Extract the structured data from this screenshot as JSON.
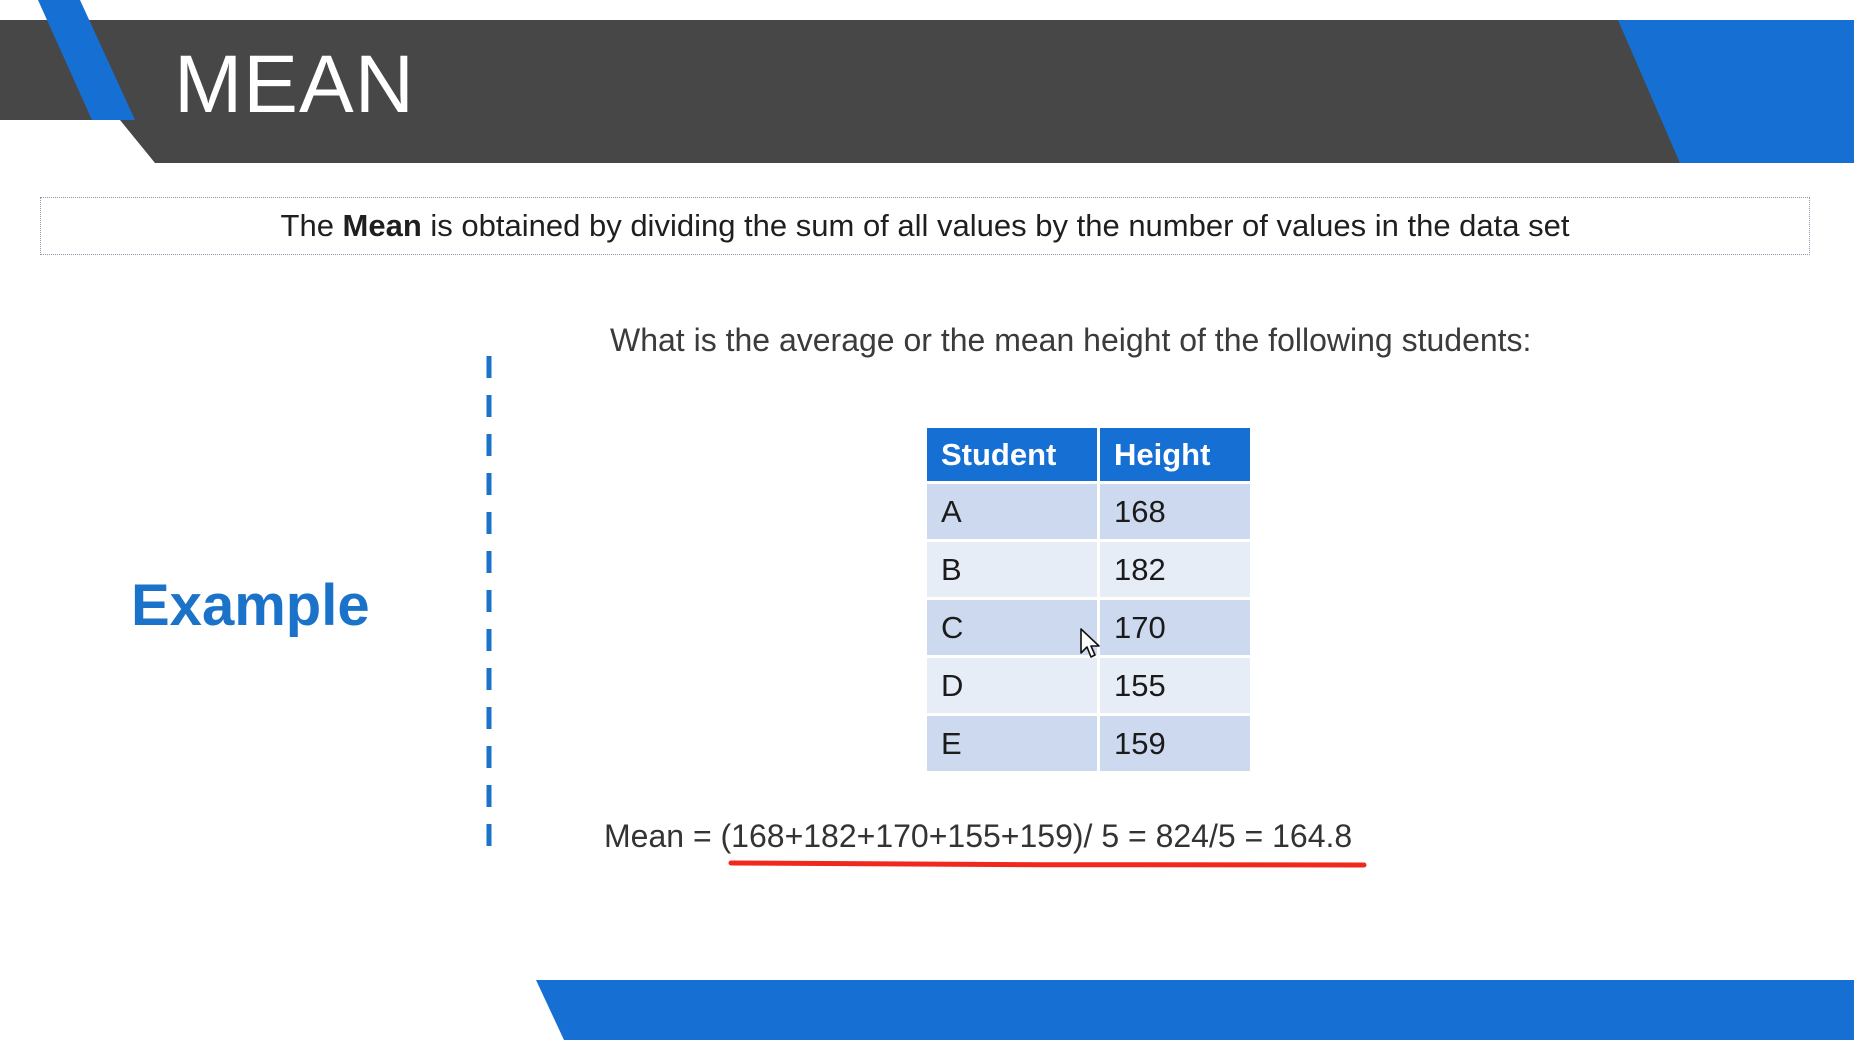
{
  "slide": {
    "title": "MEAN",
    "definition": {
      "before": "The ",
      "bold": "Mean",
      "after": " is obtained by dividing the sum of all values by the number of values in the data set"
    },
    "example_label": "Example",
    "question": "What is the average or the mean height of the following students:",
    "table": {
      "headers": [
        "Student",
        "Height"
      ],
      "rows": [
        [
          "A",
          "168"
        ],
        [
          "B",
          "182"
        ],
        [
          "C",
          "170"
        ],
        [
          "D",
          "155"
        ],
        [
          "E",
          "159"
        ]
      ]
    },
    "formula": {
      "prefix": "Mean = ",
      "expression": "(168+182+170+155+159)/ 5 = 824/5 = 164.8"
    }
  },
  "colors": {
    "header_band": "#474747",
    "accent_blue": "#1670d4",
    "underline_red": "#f0281e",
    "example_text": "#1a73c8"
  },
  "icons": {
    "cursor": "mouse-pointer-icon"
  }
}
